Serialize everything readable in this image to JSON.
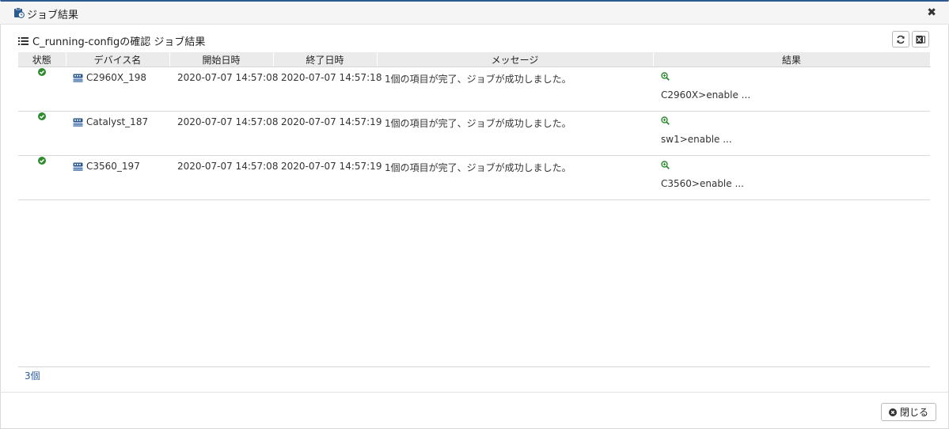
{
  "dialog": {
    "title": "ジョブ結果"
  },
  "section": {
    "title": "C_running-configの確認 ジョブ結果"
  },
  "table": {
    "columns": [
      "状態",
      "デバイス名",
      "開始日時",
      "終了日時",
      "メッセージ",
      "結果"
    ],
    "rows": [
      {
        "status": "success",
        "device": "C2960X_198",
        "start": "2020-07-07 14:57:08",
        "end": "2020-07-07 14:57:18",
        "message": "1個の項目が完了、ジョブが成功しました。",
        "result": "C2960X>enable ..."
      },
      {
        "status": "success",
        "device": "Catalyst_187",
        "start": "2020-07-07 14:57:08",
        "end": "2020-07-07 14:57:19",
        "message": "1個の項目が完了、ジョブが成功しました。",
        "result": "sw1>enable ..."
      },
      {
        "status": "success",
        "device": "C3560_197",
        "start": "2020-07-07 14:57:08",
        "end": "2020-07-07 14:57:19",
        "message": "1個の項目が完了、ジョブが成功しました。",
        "result": "C3560>enable ..."
      }
    ]
  },
  "footer": {
    "count": "3個",
    "close_label": "閉じる"
  },
  "colors": {
    "accent": "#2c5a8f",
    "success": "#2e8b2e",
    "zoom": "#2e8b2e",
    "count": "#2a5a9a"
  }
}
